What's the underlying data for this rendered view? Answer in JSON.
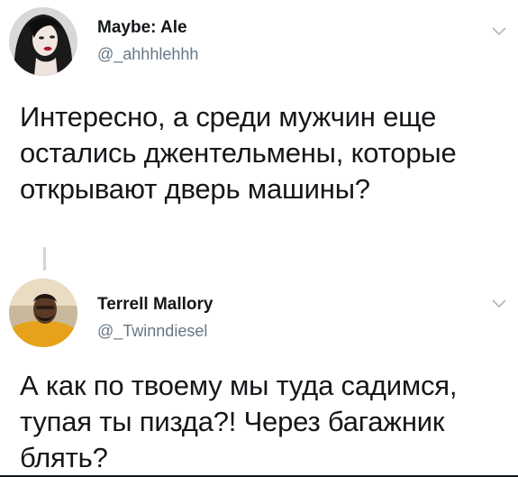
{
  "tweets": [
    {
      "display_name": "Maybe: Ale",
      "handle": "@_ahhhlehhh",
      "avatar_icon": "profile-photo",
      "menu_icon": "chevron-down-icon",
      "text": "Интересно, а среди мужчин еще остались джентельмены, которые открывают дверь машины?"
    },
    {
      "display_name": "Terrell Mallory",
      "handle": "@_Twinndiesel",
      "avatar_icon": "profile-photo",
      "menu_icon": "chevron-down-icon",
      "text": "А как по твоему мы туда садимся, тупая ты пизда?! Через багажник блять?"
    }
  ],
  "colors": {
    "text": "#14171a",
    "secondary_text": "#657786",
    "thread_line": "#ccd6dd",
    "background": "#ffffff"
  }
}
